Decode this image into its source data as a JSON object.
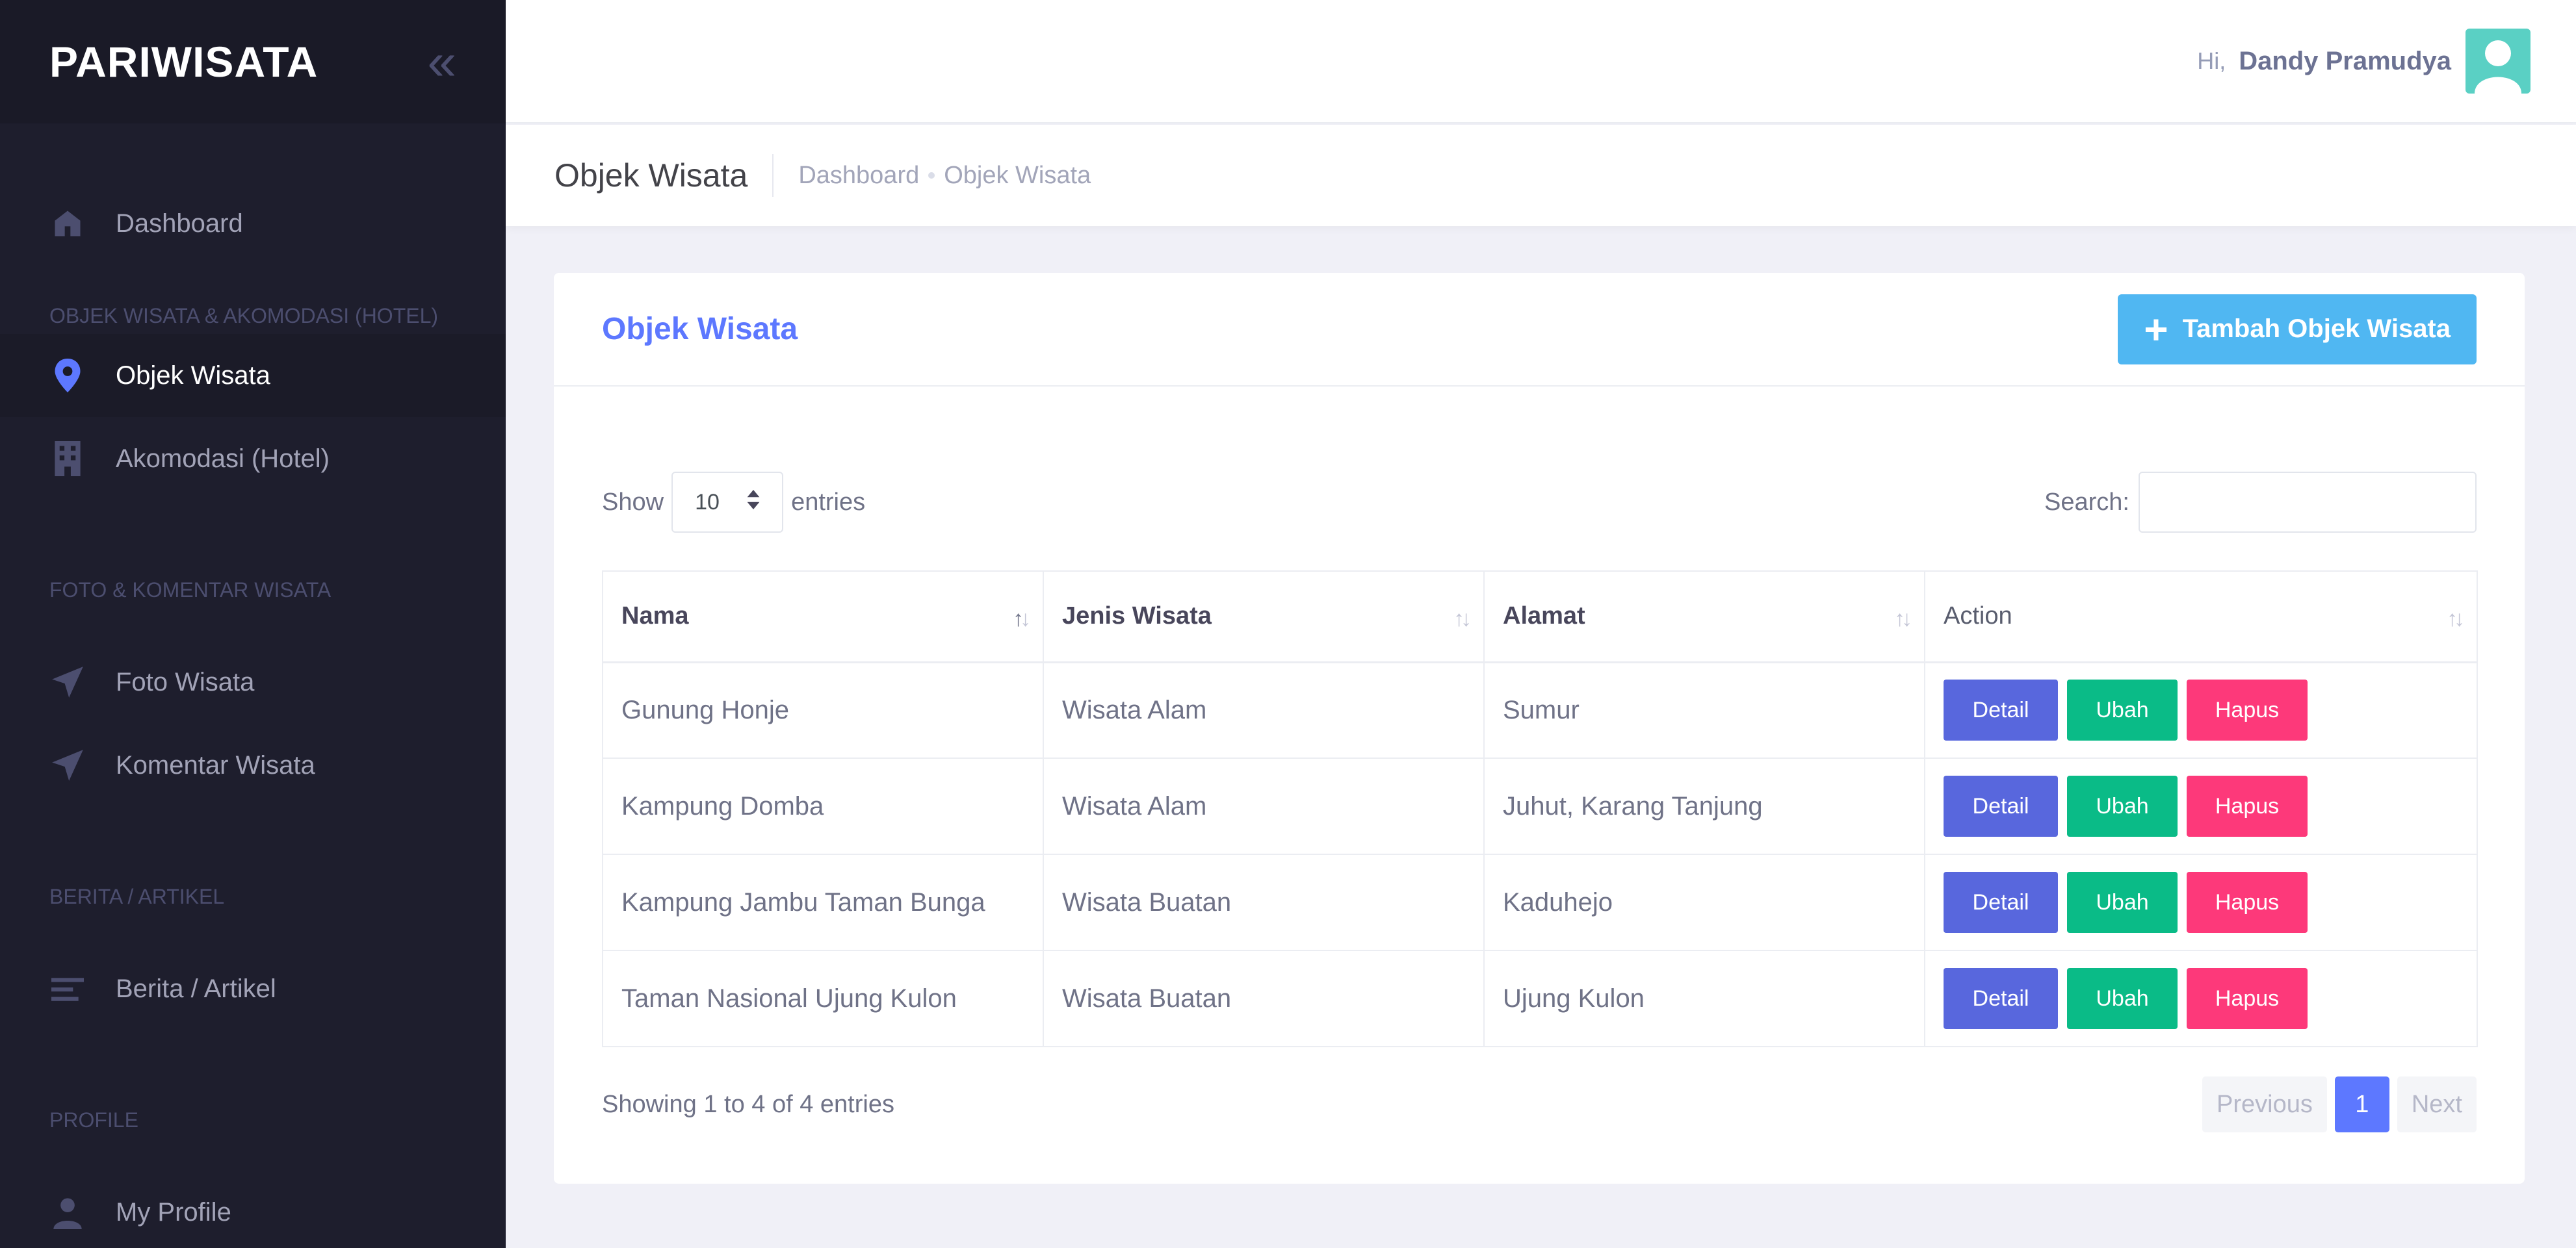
{
  "brand": {
    "title": "PARIWISATA",
    "toggle_icon": "double-chevron-left-icon"
  },
  "sidebar": {
    "dashboard": "Dashboard",
    "section_objek": "OBJEK WISATA & AKOMODASI (HOTEL)",
    "objek_wisata": "Objek Wisata",
    "akomodasi": "Akomodasi (Hotel)",
    "section_foto": "FOTO & KOMENTAR WISATA",
    "foto_wisata": "Foto Wisata",
    "komentar_wisata": "Komentar Wisata",
    "section_berita": "BERITA / ARTIKEL",
    "berita": "Berita / Artikel",
    "section_profile": "PROFILE",
    "my_profile": "My Profile"
  },
  "header": {
    "greeting": "Hi,",
    "username": "Dandy Pramudya"
  },
  "subheader": {
    "title": "Objek Wisata",
    "breadcrumb": [
      "Dashboard",
      "Objek Wisata"
    ]
  },
  "card": {
    "title": "Objek Wisata",
    "add_button": "Tambah Objek Wisata"
  },
  "table_controls": {
    "show_label": "Show",
    "page_length": "10",
    "entries_label": "entries",
    "search_label": "Search:"
  },
  "table": {
    "columns": [
      "Nama",
      "Jenis Wisata",
      "Alamat",
      "Action"
    ],
    "rows": [
      [
        "Gunung Honje",
        "Wisata Alam",
        "Sumur"
      ],
      [
        "Kampung Domba",
        "Wisata Alam",
        "Juhut, Karang Tanjung"
      ],
      [
        "Kampung Jambu Taman Bunga",
        "Wisata Buatan",
        "Kaduhejo"
      ],
      [
        "Taman Nasional Ujung Kulon",
        "Wisata Buatan",
        "Ujung Kulon"
      ]
    ],
    "actions": {
      "detail": "Detail",
      "ubah": "Ubah",
      "hapus": "Hapus"
    }
  },
  "footer": {
    "info": "Showing 1 to 4 of 4 entries",
    "previous": "Previous",
    "current_page": "1",
    "next": "Next"
  },
  "colors": {
    "sidebar_bg": "#1e1e2d",
    "accent": "#5d78ff",
    "add_button": "#50b7f2",
    "detail": "#5867dd",
    "ubah": "#0abb87",
    "hapus": "#fd397a"
  }
}
